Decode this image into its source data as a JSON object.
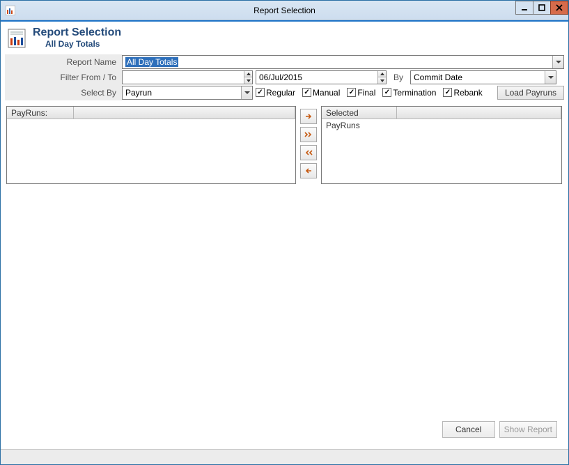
{
  "window": {
    "title": "Report Selection"
  },
  "header": {
    "heading": "Report Selection",
    "subheading": "All Day Totals"
  },
  "labels": {
    "report_name": "Report Name",
    "filter": "Filter From / To",
    "by": "By",
    "select_by": "Select By"
  },
  "fields": {
    "report_name": "All Day Totals",
    "date_from": "",
    "date_to": "06/Jul/2015",
    "by_option": "Commit Date",
    "select_by": "Payrun"
  },
  "checkboxes": {
    "regular": {
      "label": "Regular",
      "checked": true
    },
    "manual": {
      "label": "Manual",
      "checked": true
    },
    "final": {
      "label": "Final",
      "checked": true
    },
    "termination": {
      "label": "Termination",
      "checked": true
    },
    "rebank": {
      "label": "Rebank",
      "checked": true
    }
  },
  "buttons": {
    "load_payruns": "Load Payruns",
    "cancel": "Cancel",
    "show_report": "Show Report"
  },
  "lists": {
    "left_header_1": "PayRuns:",
    "left_header_2": "",
    "right_header": "Selected PayRuns"
  },
  "icons": {
    "move_right": "move-right-icon",
    "move_all_right": "move-all-right-icon",
    "move_all_left": "move-all-left-icon",
    "move_left": "move-left-icon"
  }
}
